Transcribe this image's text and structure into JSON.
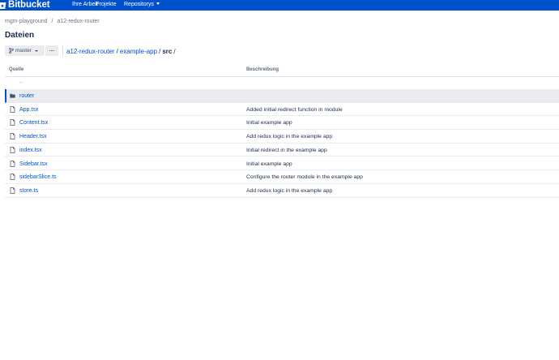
{
  "header": {
    "brand": "Bitbucket",
    "nav": [
      {
        "label": "Ihre Arbeit",
        "dropdown": false
      },
      {
        "label": "Projekte",
        "dropdown": false
      },
      {
        "label": "Repositorys",
        "dropdown": true
      }
    ],
    "bg_color": "#0052cc"
  },
  "breadcrumb": {
    "project": "mgm-playground",
    "separator": "/",
    "repo": "a12-redux-router"
  },
  "page": {
    "title": "Dateien"
  },
  "toolbar": {
    "branch": "master",
    "branch_icon": "branch-icon",
    "more_icon": "more-icon",
    "path": {
      "segments": [
        "a12-redux-router",
        "example-app"
      ],
      "current": "src",
      "separator": "/"
    }
  },
  "table": {
    "columns": [
      "Quelle",
      "Beschreibung"
    ],
    "parent": "..",
    "rows": [
      {
        "type": "folder",
        "name": "router",
        "description": "",
        "selected": true
      },
      {
        "type": "file",
        "name": "App.tsx",
        "description": "Added initial redirect function in module"
      },
      {
        "type": "file",
        "name": "Content.tsx",
        "description": "Initial example app"
      },
      {
        "type": "file",
        "name": "Header.tsx",
        "description": "Add redux logic in the example app"
      },
      {
        "type": "file",
        "name": "index.tsx",
        "description": "Initial redirect in the example app"
      },
      {
        "type": "file",
        "name": "Sidebar.tsx",
        "description": "Initial example app"
      },
      {
        "type": "file",
        "name": "sidebarSlice.ts",
        "description": "Configure the router module in the example app"
      },
      {
        "type": "file",
        "name": "store.ts",
        "description": "Add redux logic in the example app"
      }
    ]
  }
}
